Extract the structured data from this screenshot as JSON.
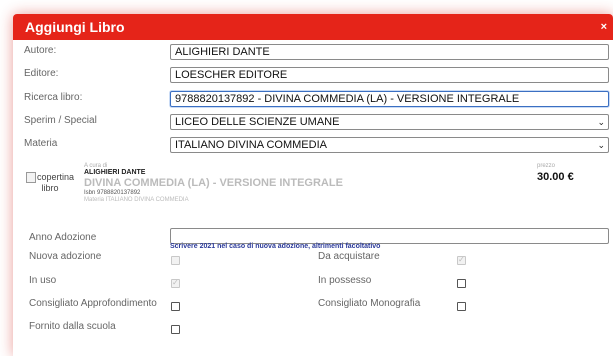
{
  "modal": {
    "title": "Aggiungi Libro",
    "close": "×"
  },
  "fields": {
    "autore": {
      "label": "Autore:",
      "value": "ALIGHIERI DANTE"
    },
    "editore": {
      "label": "Editore:",
      "value": "LOESCHER EDITORE"
    },
    "ricerca": {
      "label": "Ricerca libro:",
      "value": "9788820137892 - DIVINA COMMEDIA (LA) - VERSIONE INTEGRALE"
    },
    "sperim": {
      "label": "Sperim / Special",
      "value": "LICEO DELLE SCIENZE UMANE"
    },
    "materia": {
      "label": "Materia",
      "value": "ITALIANO DIVINA COMMEDIA"
    }
  },
  "book": {
    "cover_alt": "copertina libro",
    "curato_label": "A cura di",
    "author": "ALIGHIERI DANTE",
    "title": "DIVINA COMMEDIA (LA) - VERSIONE INTEGRALE",
    "isbn": "Isbn 9788820137892",
    "materia": "Materia ITALIANO DIVINA COMMEDIA",
    "price_label": "prezzo",
    "price": "30.00 €"
  },
  "adozione": {
    "label": "Anno Adozione",
    "value": "",
    "hint": "Scrivere 2021 nel caso di nuova adozione, altrimenti facoltativo"
  },
  "checkboxes": {
    "nuova_adozione": {
      "label": "Nuova adozione",
      "checked": false,
      "disabled": true
    },
    "da_acquistare": {
      "label": "Da acquistare",
      "checked": true,
      "disabled": true
    },
    "in_uso": {
      "label": "In uso",
      "checked": true,
      "disabled": true
    },
    "in_possesso": {
      "label": "In possesso",
      "checked": false,
      "disabled": false
    },
    "consigliato_approfondimento": {
      "label": "Consigliato Approfondimento",
      "checked": false,
      "disabled": false
    },
    "consigliato_monografia": {
      "label": "Consigliato Monografia",
      "checked": false,
      "disabled": false
    },
    "fornito_scuola": {
      "label": "Fornito dalla scuola",
      "checked": false,
      "disabled": false
    }
  },
  "colors": {
    "header": "#e52419",
    "hint": "#2b3a9a"
  }
}
